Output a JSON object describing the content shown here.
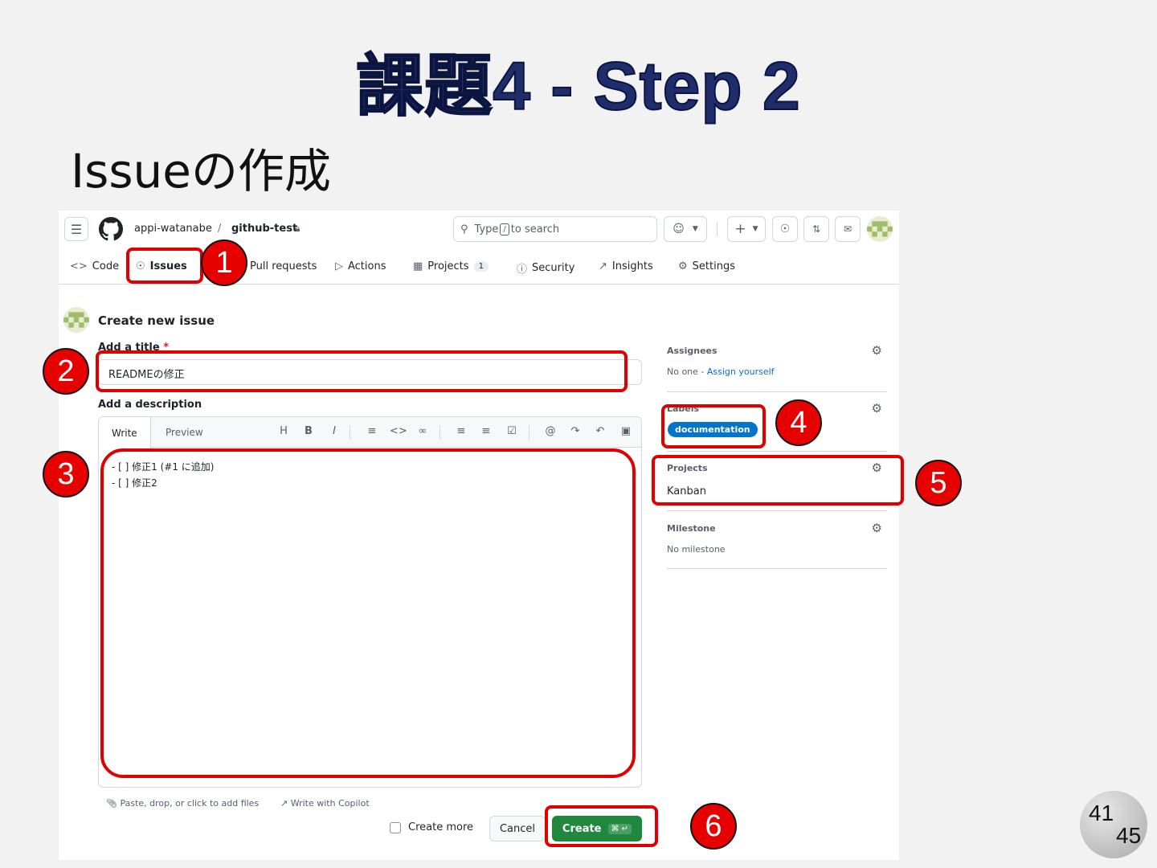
{
  "slide": {
    "title": "課題4 - Step 2",
    "subtitle": "Issueの作成",
    "page_current": "41",
    "page_total": "45"
  },
  "header": {
    "owner": "appi-watanabe",
    "separator": "/",
    "repo": "github-test",
    "search_prefix": "Type",
    "search_key": "/",
    "search_suffix": "to search"
  },
  "tabs": [
    {
      "label": "Code",
      "icon": "code-icon"
    },
    {
      "label": "Issues",
      "icon": "issue-icon"
    },
    {
      "label": "Pull requests",
      "icon": "pull-request-icon"
    },
    {
      "label": "Actions",
      "icon": "play-icon"
    },
    {
      "label": "Projects",
      "icon": "table-icon",
      "count": "1"
    },
    {
      "label": "Security",
      "icon": "shield-icon"
    },
    {
      "label": "Insights",
      "icon": "graph-icon"
    },
    {
      "label": "Settings",
      "icon": "gear-icon"
    }
  ],
  "form": {
    "heading": "Create new issue",
    "title_label": "Add a title",
    "required_mark": "*",
    "title_value": "READMEの修正",
    "description_label": "Add a description",
    "write_tab": "Write",
    "preview_tab": "Preview",
    "toolbar": {
      "heading": "H",
      "bold": "B",
      "italic": "I"
    },
    "body_lines": [
      "- [ ] 修正1 (#1 に追加)",
      "- [ ] 修正2"
    ],
    "attach_hint": "Paste, drop, or click to add files",
    "copilot_hint": "Write with Copilot",
    "create_more": "Create more",
    "cancel": "Cancel",
    "create": "Create",
    "create_shortcut": "⌘ ↵"
  },
  "sidebar": {
    "assignees_label": "Assignees",
    "assignees_none": "No one -",
    "assign_yourself": "Assign yourself",
    "labels_label": "Labels",
    "label_value": "documentation",
    "projects_label": "Projects",
    "project_value": "Kanban",
    "milestone_label": "Milestone",
    "milestone_value": "No milestone"
  },
  "annotations": [
    "1",
    "2",
    "3",
    "4",
    "5",
    "6"
  ],
  "colors": {
    "highlight": "#e00000",
    "badge": "#e60000",
    "create_button": "#1f883d",
    "label_pill": "#0075ca",
    "title": "#1f2d6b"
  }
}
